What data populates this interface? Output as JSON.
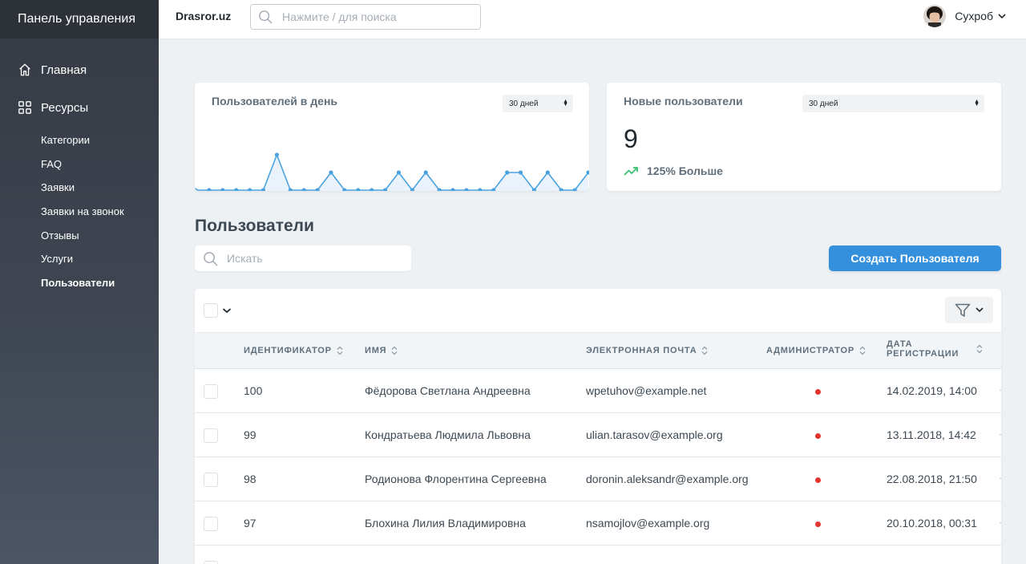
{
  "sidebar": {
    "title": "Панель управления",
    "main_items": [
      {
        "label": "Главная",
        "icon": "home-icon"
      },
      {
        "label": "Ресурсы",
        "icon": "grid-icon"
      }
    ],
    "sub_items": [
      {
        "label": "Категории",
        "active": false
      },
      {
        "label": "FAQ",
        "active": false
      },
      {
        "label": "Заявки",
        "active": false
      },
      {
        "label": "Заявки на звонок",
        "active": false
      },
      {
        "label": "Отзывы",
        "active": false
      },
      {
        "label": "Услуги",
        "active": false
      },
      {
        "label": "Пользователи",
        "active": true
      }
    ]
  },
  "topbar": {
    "brand": "Drasror.uz",
    "search_placeholder": "Нажмите / для поиска",
    "user_name": "Сухроб"
  },
  "cards": {
    "per_day": {
      "title": "Пользователей в день",
      "period": "30 дней",
      "series": [
        0,
        0,
        0,
        0,
        0,
        0,
        2,
        0,
        0,
        0,
        1,
        0,
        0,
        0,
        0,
        1,
        0,
        1,
        0,
        0,
        0,
        0,
        0,
        1,
        1,
        0,
        1,
        0,
        0,
        1
      ]
    },
    "new_users": {
      "title": "Новые пользователи",
      "period": "30 дней",
      "value": "9",
      "trend": "125% Больше"
    }
  },
  "users": {
    "title": "Пользователи",
    "search_placeholder": "Искать",
    "create_label": "Создать Пользователя",
    "columns": {
      "id": "ИДЕНТИФИКАТОР",
      "name": "ИМЯ",
      "email": "ЭЛЕКТРОННАЯ ПОЧТА",
      "admin": "АДМИНИСТРАТОР",
      "date_line1": "ДАТА",
      "date_line2": "РЕГИСТРАЦИИ"
    },
    "rows": [
      {
        "id": "100",
        "name": "Фёдорова Светлана Андреевна",
        "email": "wpetuhov@example.net",
        "admin": false,
        "date": "14.02.2019, 14:00"
      },
      {
        "id": "99",
        "name": "Кондратьева Людмила Львовна",
        "email": "ulian.tarasov@example.org",
        "admin": false,
        "date": "13.11.2018, 14:42"
      },
      {
        "id": "98",
        "name": "Родионова Флорентина Сергеевна",
        "email": "doronin.aleksandr@example.org",
        "admin": false,
        "date": "22.08.2018, 21:50"
      },
      {
        "id": "97",
        "name": "Блохина Лилия Владимировна",
        "email": "nsamojlov@example.org",
        "admin": false,
        "date": "20.10.2018, 00:31"
      }
    ]
  },
  "colors": {
    "accent": "#3490dc",
    "admin_false_dot": "#e3342f",
    "trend_up": "#38c172"
  }
}
